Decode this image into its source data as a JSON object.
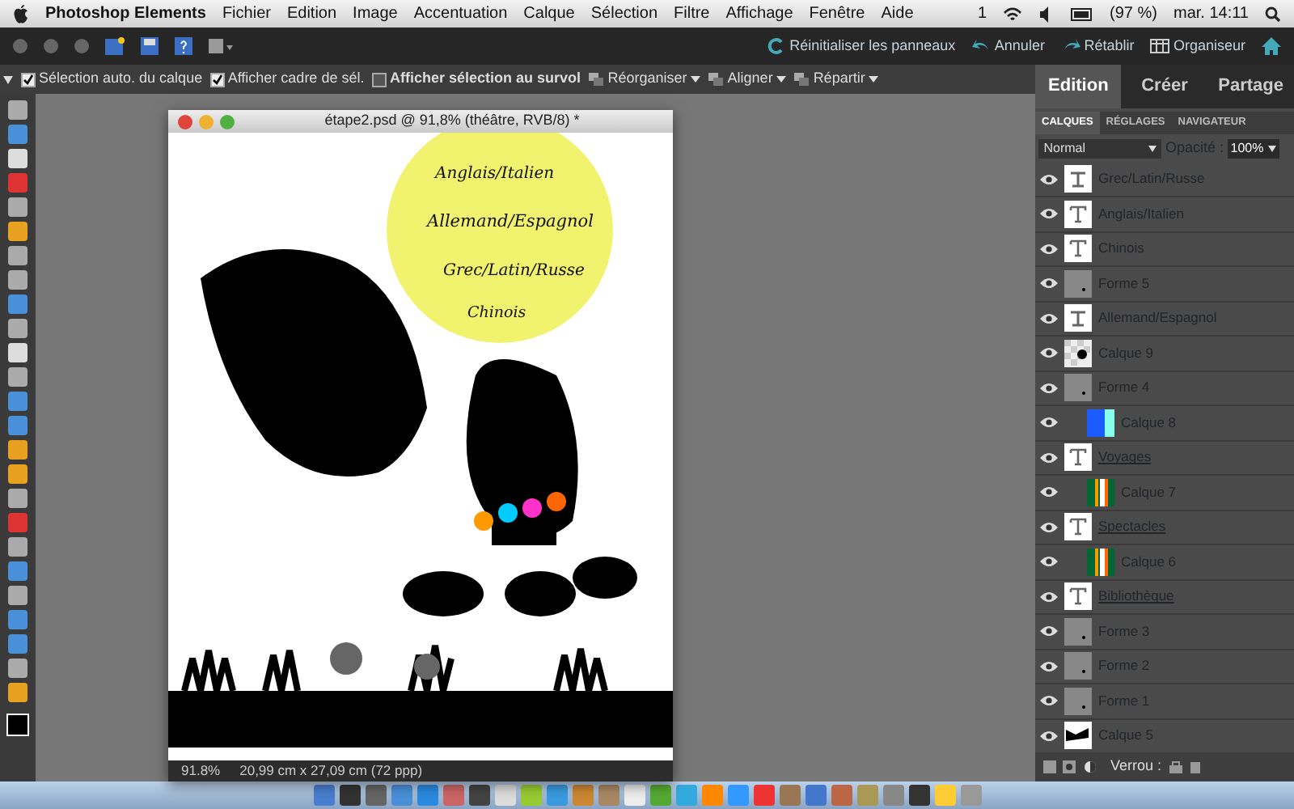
{
  "menubar": {
    "app": "Photoshop Elements",
    "menus": [
      "Fichier",
      "Edition",
      "Image",
      "Accentuation",
      "Calque",
      "Sélection",
      "Filtre",
      "Affichage",
      "Fenêtre",
      "Aide"
    ],
    "status": [
      "1",
      "(97 %)",
      "mar. 14:11"
    ]
  },
  "appbar": {
    "actions": [
      "Réinitialiser les panneaux",
      "Annuler",
      "Rétablir",
      "Organiseur"
    ]
  },
  "options": [
    {
      "kind": "check",
      "label": "Sélection auto. du calque",
      "checked": true
    },
    {
      "kind": "check",
      "label": "Afficher cadre de sél.",
      "checked": true
    },
    {
      "kind": "check",
      "label": "Afficher sélection au survol",
      "checked": false
    },
    {
      "kind": "menu",
      "label": "Réorganiser"
    },
    {
      "kind": "menu",
      "label": "Aligner"
    },
    {
      "kind": "menu",
      "label": "Répartir"
    }
  ],
  "mode_tabs": [
    {
      "label": "Edition",
      "selected": true
    },
    {
      "label": "Créer",
      "selected": false
    },
    {
      "label": "Partage",
      "selected": false
    }
  ],
  "document": {
    "title": "étape2.psd @ 91,8% (théâtre, RVB/8) *",
    "artwork_texts": [
      "Anglais/Italien",
      "Allemand/Espagnol",
      "Grec/Latin/Russe",
      "Chinois"
    ],
    "zoom": "91.8%",
    "size": "20,99 cm x 27,09 cm (72 ppp)"
  },
  "layers_panel": {
    "tabs": [
      {
        "label": "CALQUES",
        "selected": true
      },
      {
        "label": "RÉGLAGES",
        "selected": false
      },
      {
        "label": "NAVIGATEUR",
        "selected": false
      }
    ],
    "blend_mode": "Normal",
    "opacity_label": "Opacité :",
    "opacity": "100%",
    "lock_label": "Verrou :",
    "layers": [
      {
        "name": "Grec/Latin/Russe",
        "kind": "warp",
        "clipped": false,
        "underlined": false
      },
      {
        "name": "Anglais/Italien",
        "kind": "text",
        "clipped": false,
        "underlined": false
      },
      {
        "name": "Chinois",
        "kind": "text",
        "clipped": false,
        "underlined": false
      },
      {
        "name": "Forme 5",
        "kind": "shape",
        "clipped": false,
        "underlined": false
      },
      {
        "name": "Allemand/Espagnol",
        "kind": "warp",
        "clipped": false,
        "underlined": false
      },
      {
        "name": "Calque 9",
        "kind": "transparent",
        "clipped": false,
        "underlined": false
      },
      {
        "name": "Forme 4",
        "kind": "shape",
        "clipped": false,
        "underlined": false
      },
      {
        "name": "Calque 8",
        "kind": "gradient",
        "clipped": true,
        "underlined": false
      },
      {
        "name": "Voyages",
        "kind": "text",
        "clipped": false,
        "underlined": true
      },
      {
        "name": "Calque 7",
        "kind": "stripes",
        "clipped": true,
        "underlined": false
      },
      {
        "name": "Spectacles",
        "kind": "text",
        "clipped": false,
        "underlined": true
      },
      {
        "name": "Calque 6",
        "kind": "stripes",
        "clipped": true,
        "underlined": false
      },
      {
        "name": "Bibliothèque",
        "kind": "text",
        "clipped": false,
        "underlined": true
      },
      {
        "name": "Forme 3",
        "kind": "shape",
        "clipped": false,
        "underlined": false
      },
      {
        "name": "Forme 2",
        "kind": "shape",
        "clipped": false,
        "underlined": false
      },
      {
        "name": "Forme 1",
        "kind": "shape",
        "clipped": false,
        "underlined": false
      },
      {
        "name": "Calque 5",
        "kind": "image",
        "clipped": false,
        "underlined": false
      }
    ]
  }
}
